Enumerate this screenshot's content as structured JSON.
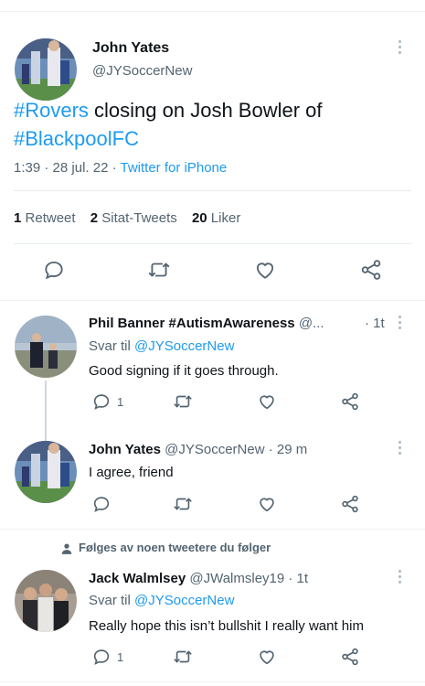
{
  "main_tweet": {
    "author_name": "John Yates",
    "author_handle": "@JYSoccerNew",
    "text_hashtag_1": "#Rovers",
    "text_middle": " closing on Josh Bowler of",
    "text_hashtag_2": "#BlackpoolFC",
    "time": "1:39",
    "dot1": " · ",
    "date": "28 jul. 22",
    "dot2": " · ",
    "source": "Twitter for iPhone",
    "stats": {
      "retweets_count": "1",
      "retweets_label": "Retweet",
      "quotes_count": "2",
      "quotes_label": "Sitat-Tweets",
      "likes_count": "20",
      "likes_label": "Liker"
    }
  },
  "replies": [
    {
      "author_name": "Phil Banner #AutismAwareness",
      "author_handle": "@...",
      "time": "· 1t",
      "reply_to_label": "Svar til ",
      "reply_to_handle": "@JYSoccerNew",
      "text": "Good signing if it goes through.",
      "reply_count": "1"
    },
    {
      "author_name": "John Yates",
      "author_handle": "@JYSoccerNew",
      "time": "· 29 m",
      "text": "I agree, friend"
    },
    {
      "social_context": "Følges av noen tweetere du følger",
      "author_name": "Jack Walmlsey",
      "author_handle": "@JWalmsley19",
      "time": "· 1t",
      "reply_to_label": "Svar til ",
      "reply_to_handle": "@JYSoccerNew",
      "text": "Really hope this isn’t bullshit I really want him",
      "reply_count": "1"
    }
  ],
  "icons": {
    "reply": "reply-icon",
    "retweet": "retweet-icon",
    "like": "heart-icon",
    "share": "share-icon",
    "more": "more-icon",
    "person": "person-icon"
  },
  "colors": {
    "accent": "#1d9bf0",
    "secondary_text": "#536471",
    "primary_text": "#0f1419"
  }
}
